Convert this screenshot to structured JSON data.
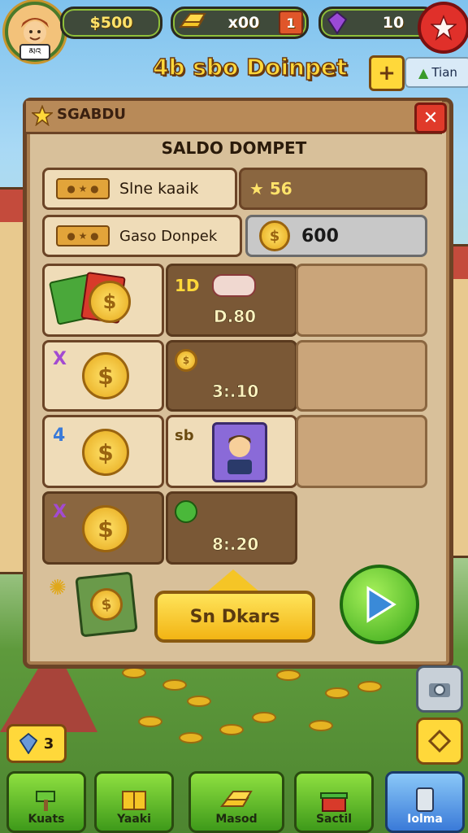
{
  "topbar": {
    "player_tag": "མའ",
    "cash_value": "$500",
    "gold_value": "x00",
    "gold_badge": "1",
    "gem_value": "10"
  },
  "header": {
    "title": "4b sbo Doinpet",
    "right_label": "Tian"
  },
  "panel": {
    "tab_title": "SGABDU",
    "close_label": "✕",
    "heading": "SALDO DOMPET",
    "balance_row": {
      "label": "Slne kaaik",
      "value": "★ 56"
    },
    "wallet_row": {
      "label": "Gaso Donpek",
      "value": "600"
    },
    "offers": [
      {
        "badge": "1D",
        "amount": "D.80"
      },
      {
        "badge": "X",
        "amount": "3:.10"
      },
      {
        "badge": "4",
        "badge2": "sb"
      },
      {
        "badge": "X",
        "amount": "8:.20"
      }
    ],
    "cta_label": "Sn Dkars"
  },
  "side": {
    "gem_count": "3"
  },
  "nav": [
    "Kuats",
    "Yaaki",
    "Masod",
    "Sactil",
    "Iolma"
  ],
  "colors": {
    "accent_gold": "#ffd83a",
    "panel_wood": "#d8c09a",
    "play_green": "#3aa81a"
  }
}
